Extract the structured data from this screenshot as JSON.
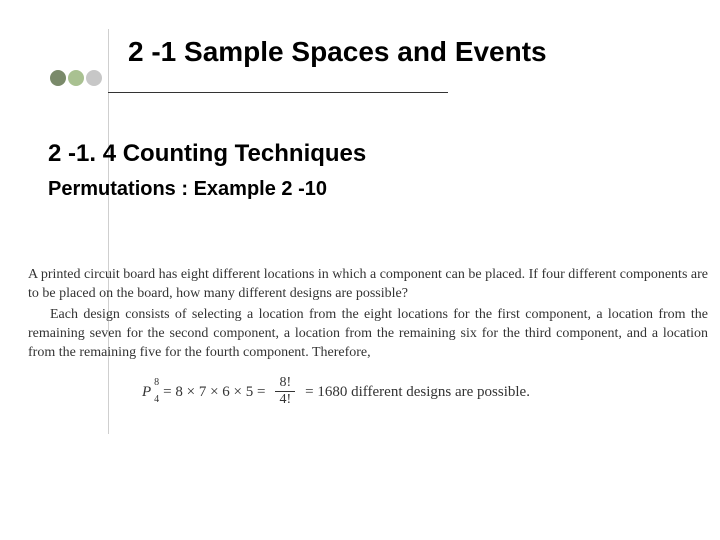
{
  "title": "2 -1 Sample Spaces and Events",
  "subsection": "2 -1. 4 Counting Techniques",
  "subhead": "Permutations : Example 2 -10",
  "para1": "A printed circuit board has eight different locations in which a component can be placed. If four different components are to be placed on the board, how many different designs are possible?",
  "para2": "Each design consists of selecting a location from the eight locations for the first component, a location from the remaining seven for the second component, a location from the remaining six for the third component, and a location from the remaining five for the fourth component. Therefore,",
  "formula": {
    "P_letter": "P",
    "P_sup": "8",
    "P_sub": "4",
    "eq1": "= 8 × 7 × 6 × 5 =",
    "frac_num": "8!",
    "frac_den": "4!",
    "eq2": "= 1680 different designs are possible."
  }
}
